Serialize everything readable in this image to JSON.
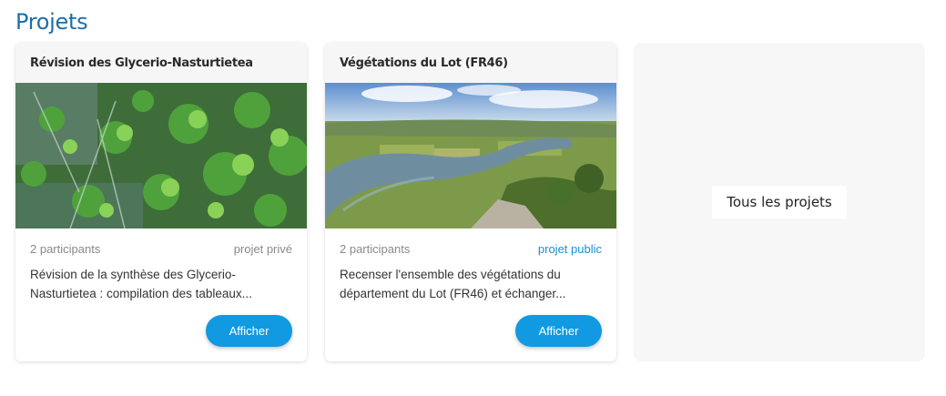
{
  "section": {
    "title": "Projets"
  },
  "projects": [
    {
      "name": "Révision des Glycerio-Nasturtietea",
      "participants": "2 participants",
      "visibility": "projet privé",
      "description": "Révision de la synthèse des Glycerio-Nasturtietea : compilation des tableaux...",
      "action_label": "Afficher",
      "image": "aquatic-watercress-vegetation-photo"
    },
    {
      "name": "Végétations du Lot (FR46)",
      "participants": "2 participants",
      "visibility": "projet public",
      "description": "Recenser l'ensemble des végétations du département du Lot (FR46) et échanger...",
      "action_label": "Afficher",
      "image": "river-valley-landscape-photo"
    }
  ],
  "all_projects": {
    "label": "Tous les projets"
  },
  "colors": {
    "title": "#1b6fa8",
    "button": "#119ae2",
    "public_badge": "#1a8fd0",
    "private_badge": "#8a8a8a"
  }
}
